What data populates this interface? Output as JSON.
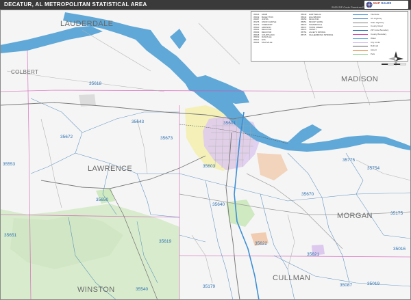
{
  "header": {
    "title": "DECATUR, AL METROPOLITAN STATISTICAL AREA",
    "edition": "2020 ZIP Code Premium Edition",
    "logo_line1": "MAP",
    "logo_line2": "SALES"
  },
  "counties": [
    {
      "name": "LAUDERDALE",
      "size": "large"
    },
    {
      "name": "COLBERT",
      "size": "small"
    },
    {
      "name": "LAWRENCE",
      "size": "large"
    },
    {
      "name": "MADISON",
      "size": "large"
    },
    {
      "name": "MORGAN",
      "size": "large"
    },
    {
      "name": "WINSTON",
      "size": "large"
    },
    {
      "name": "CULLMAN",
      "size": "large"
    }
  ],
  "zip_codes": [
    "35618",
    "35643",
    "35672",
    "35673",
    "35601",
    "35603",
    "35622",
    "35651",
    "35650",
    "35640",
    "35619",
    "35621",
    "35670",
    "35775",
    "35754",
    "35175",
    "35016",
    "35179",
    "35540",
    "35087",
    "35019",
    "35553"
  ],
  "legend": {
    "zip_table_rows": [
      {
        "zip": "35016",
        "name": "ARAB",
        "pop": ""
      },
      {
        "zip": "35019",
        "name": "BAILEYTON",
        "pop": ""
      },
      {
        "zip": "35087",
        "name": "JOPPA",
        "pop": ""
      },
      {
        "zip": "35175",
        "name": "UNION GROVE",
        "pop": ""
      },
      {
        "zip": "35179",
        "name": "VINEMONT",
        "pop": ""
      },
      {
        "zip": "35540",
        "name": "ADDISON",
        "pop": ""
      },
      {
        "zip": "35601",
        "name": "DECATUR",
        "pop": ""
      },
      {
        "zip": "35603",
        "name": "DECATUR",
        "pop": ""
      },
      {
        "zip": "35618",
        "name": "COURTLAND",
        "pop": ""
      },
      {
        "zip": "35619",
        "name": "DANVILLE",
        "pop": ""
      },
      {
        "zip": "35621",
        "name": "EVA",
        "pop": ""
      },
      {
        "zip": "35622",
        "name": "FALKVILLE",
        "pop": ""
      }
    ],
    "zip_table_rows2": [
      {
        "zip": "35640",
        "name": "HARTSELLE",
        "pop": ""
      },
      {
        "zip": "35643",
        "name": "HILLSBORO",
        "pop": ""
      },
      {
        "zip": "35650",
        "name": "MOULTON",
        "pop": ""
      },
      {
        "zip": "35651",
        "name": "MOUNT HOPE",
        "pop": ""
      },
      {
        "zip": "35670",
        "name": "SOMERVILLE",
        "pop": ""
      },
      {
        "zip": "35672",
        "name": "TOWN CREEK",
        "pop": ""
      },
      {
        "zip": "35673",
        "name": "TRINITY",
        "pop": ""
      },
      {
        "zip": "35754",
        "name": "LACEYS SPRING",
        "pop": ""
      },
      {
        "zip": "35775",
        "name": "VALHERMOSO SPRINGS",
        "pop": ""
      }
    ],
    "items": [
      {
        "label": "Interstate",
        "color": "#3c8fd6"
      },
      {
        "label": "US Highway",
        "color": "#2c6cb0"
      },
      {
        "label": "State Highway",
        "color": "#7a7a7a"
      },
      {
        "label": "County Road",
        "color": "#b3b3b3"
      },
      {
        "label": "ZIP Code Boundary",
        "color": "#2a6fb0"
      },
      {
        "label": "County Boundary",
        "color": "#d04fb0"
      },
      {
        "label": "Water",
        "color": "#5fa8d8"
      },
      {
        "label": "City Limits",
        "color": "#c9b3e6"
      },
      {
        "label": "Railroad",
        "color": "#555555"
      },
      {
        "label": "Airport",
        "color": "#e07c2a"
      },
      {
        "label": "Park",
        "color": "#9fd39a"
      }
    ]
  },
  "colors": {
    "water": "#5fa8d8",
    "forest": "#d8eccd",
    "county_line": "#d04fb0",
    "zip_line": "#2a6fb0",
    "city_yellow": "#f4f0b8",
    "city_purple": "#ddc9ee",
    "city_orange": "#f1ccb0",
    "city_green": "#cfe9c0",
    "background": "#f4f4f4"
  }
}
